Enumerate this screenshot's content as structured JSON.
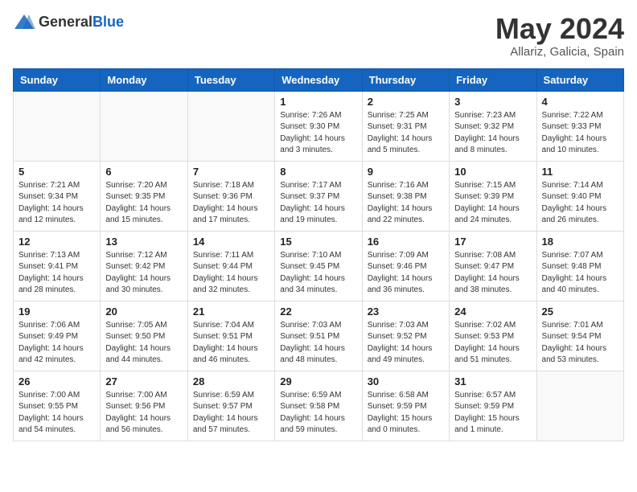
{
  "header": {
    "logo_general": "General",
    "logo_blue": "Blue",
    "month": "May 2024",
    "location": "Allariz, Galicia, Spain"
  },
  "weekdays": [
    "Sunday",
    "Monday",
    "Tuesday",
    "Wednesday",
    "Thursday",
    "Friday",
    "Saturday"
  ],
  "weeks": [
    [
      {
        "day": "",
        "info": ""
      },
      {
        "day": "",
        "info": ""
      },
      {
        "day": "",
        "info": ""
      },
      {
        "day": "1",
        "info": "Sunrise: 7:26 AM\nSunset: 9:30 PM\nDaylight: 14 hours\nand 3 minutes."
      },
      {
        "day": "2",
        "info": "Sunrise: 7:25 AM\nSunset: 9:31 PM\nDaylight: 14 hours\nand 5 minutes."
      },
      {
        "day": "3",
        "info": "Sunrise: 7:23 AM\nSunset: 9:32 PM\nDaylight: 14 hours\nand 8 minutes."
      },
      {
        "day": "4",
        "info": "Sunrise: 7:22 AM\nSunset: 9:33 PM\nDaylight: 14 hours\nand 10 minutes."
      }
    ],
    [
      {
        "day": "5",
        "info": "Sunrise: 7:21 AM\nSunset: 9:34 PM\nDaylight: 14 hours\nand 12 minutes."
      },
      {
        "day": "6",
        "info": "Sunrise: 7:20 AM\nSunset: 9:35 PM\nDaylight: 14 hours\nand 15 minutes."
      },
      {
        "day": "7",
        "info": "Sunrise: 7:18 AM\nSunset: 9:36 PM\nDaylight: 14 hours\nand 17 minutes."
      },
      {
        "day": "8",
        "info": "Sunrise: 7:17 AM\nSunset: 9:37 PM\nDaylight: 14 hours\nand 19 minutes."
      },
      {
        "day": "9",
        "info": "Sunrise: 7:16 AM\nSunset: 9:38 PM\nDaylight: 14 hours\nand 22 minutes."
      },
      {
        "day": "10",
        "info": "Sunrise: 7:15 AM\nSunset: 9:39 PM\nDaylight: 14 hours\nand 24 minutes."
      },
      {
        "day": "11",
        "info": "Sunrise: 7:14 AM\nSunset: 9:40 PM\nDaylight: 14 hours\nand 26 minutes."
      }
    ],
    [
      {
        "day": "12",
        "info": "Sunrise: 7:13 AM\nSunset: 9:41 PM\nDaylight: 14 hours\nand 28 minutes."
      },
      {
        "day": "13",
        "info": "Sunrise: 7:12 AM\nSunset: 9:42 PM\nDaylight: 14 hours\nand 30 minutes."
      },
      {
        "day": "14",
        "info": "Sunrise: 7:11 AM\nSunset: 9:44 PM\nDaylight: 14 hours\nand 32 minutes."
      },
      {
        "day": "15",
        "info": "Sunrise: 7:10 AM\nSunset: 9:45 PM\nDaylight: 14 hours\nand 34 minutes."
      },
      {
        "day": "16",
        "info": "Sunrise: 7:09 AM\nSunset: 9:46 PM\nDaylight: 14 hours\nand 36 minutes."
      },
      {
        "day": "17",
        "info": "Sunrise: 7:08 AM\nSunset: 9:47 PM\nDaylight: 14 hours\nand 38 minutes."
      },
      {
        "day": "18",
        "info": "Sunrise: 7:07 AM\nSunset: 9:48 PM\nDaylight: 14 hours\nand 40 minutes."
      }
    ],
    [
      {
        "day": "19",
        "info": "Sunrise: 7:06 AM\nSunset: 9:49 PM\nDaylight: 14 hours\nand 42 minutes."
      },
      {
        "day": "20",
        "info": "Sunrise: 7:05 AM\nSunset: 9:50 PM\nDaylight: 14 hours\nand 44 minutes."
      },
      {
        "day": "21",
        "info": "Sunrise: 7:04 AM\nSunset: 9:51 PM\nDaylight: 14 hours\nand 46 minutes."
      },
      {
        "day": "22",
        "info": "Sunrise: 7:03 AM\nSunset: 9:51 PM\nDaylight: 14 hours\nand 48 minutes."
      },
      {
        "day": "23",
        "info": "Sunrise: 7:03 AM\nSunset: 9:52 PM\nDaylight: 14 hours\nand 49 minutes."
      },
      {
        "day": "24",
        "info": "Sunrise: 7:02 AM\nSunset: 9:53 PM\nDaylight: 14 hours\nand 51 minutes."
      },
      {
        "day": "25",
        "info": "Sunrise: 7:01 AM\nSunset: 9:54 PM\nDaylight: 14 hours\nand 53 minutes."
      }
    ],
    [
      {
        "day": "26",
        "info": "Sunrise: 7:00 AM\nSunset: 9:55 PM\nDaylight: 14 hours\nand 54 minutes."
      },
      {
        "day": "27",
        "info": "Sunrise: 7:00 AM\nSunset: 9:56 PM\nDaylight: 14 hours\nand 56 minutes."
      },
      {
        "day": "28",
        "info": "Sunrise: 6:59 AM\nSunset: 9:57 PM\nDaylight: 14 hours\nand 57 minutes."
      },
      {
        "day": "29",
        "info": "Sunrise: 6:59 AM\nSunset: 9:58 PM\nDaylight: 14 hours\nand 59 minutes."
      },
      {
        "day": "30",
        "info": "Sunrise: 6:58 AM\nSunset: 9:59 PM\nDaylight: 15 hours\nand 0 minutes."
      },
      {
        "day": "31",
        "info": "Sunrise: 6:57 AM\nSunset: 9:59 PM\nDaylight: 15 hours\nand 1 minute."
      },
      {
        "day": "",
        "info": ""
      }
    ]
  ]
}
